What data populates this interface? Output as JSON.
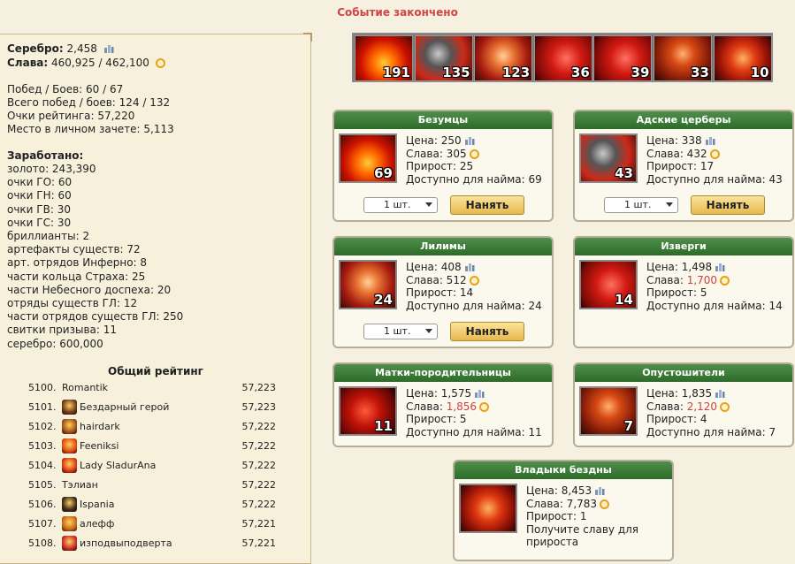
{
  "title": "Событие закончено",
  "stats": {
    "silver_label": "Серебро:",
    "silver_value": "2,458",
    "glory_label": "Слава:",
    "glory_value": "460,925 / 462,100",
    "wins": "Побед / Боев: 60 / 67",
    "total_wins": "Всего побед / боев: 124 / 132",
    "rating_points": "Очки рейтинга: 57,220",
    "personal_place": "Место в личном зачете: 5,113"
  },
  "earned": {
    "heading": "Заработано:",
    "items": [
      "золото: 243,390",
      "очки ГО: 60",
      "очки ГН: 60",
      "очки ГВ: 30",
      "очки ГС: 30",
      "бриллианты: 2",
      "артефакты существ: 72",
      "арт. отрядов Инферно: 8",
      "части кольца Страха: 25",
      "части Небесного доспеха: 20",
      "отряды существ ГЛ: 12",
      "части отрядов существ ГЛ: 250",
      "свитки призыва: 11",
      "серебро: 600,000"
    ]
  },
  "ranking": {
    "title": "Общий рейтинг",
    "rows": [
      {
        "pos": "5100.",
        "name": "Romantik",
        "points": "57,223",
        "avatar": null
      },
      {
        "pos": "5101.",
        "name": "Бездарный герой",
        "points": "57,223",
        "avatar": "#6b3a1c"
      },
      {
        "pos": "5102.",
        "name": "hairdark",
        "points": "57,222",
        "avatar": "#a0521a"
      },
      {
        "pos": "5103.",
        "name": "Feeniksi",
        "points": "57,222",
        "avatar": "#e24a10"
      },
      {
        "pos": "5104.",
        "name": "Lady SladurAna",
        "points": "57,222",
        "avatar": "#d83a14"
      },
      {
        "pos": "5105.",
        "name": "Тэлиан",
        "points": "57,222",
        "avatar": null
      },
      {
        "pos": "5106.",
        "name": "Ispania",
        "points": "57,222",
        "avatar": "#3a2a1a"
      },
      {
        "pos": "5107.",
        "name": "алефф",
        "points": "57,221",
        "avatar": "#c86a18"
      },
      {
        "pos": "5108.",
        "name": "изподвыподверта",
        "points": "57,221",
        "avatar": "#c82a2a"
      }
    ]
  },
  "strip": [
    {
      "count": "191",
      "art": "art-fire",
      "icon": "fire-icon"
    },
    {
      "count": "135",
      "art": "art-hound",
      "icon": "hound-icon"
    },
    {
      "count": "123",
      "art": "art-lilim",
      "icon": "lilim-icon"
    },
    {
      "count": "36",
      "art": "art-fiend",
      "icon": "fiend-icon"
    },
    {
      "count": "39",
      "art": "art-fiend",
      "icon": "fiend-icon"
    },
    {
      "count": "33",
      "art": "art-ravager",
      "icon": "ravager-icon"
    },
    {
      "count": "10",
      "art": "art-lord",
      "icon": "lord-icon"
    }
  ],
  "cards": {
    "bezumcy": {
      "title": "Безумцы",
      "count": "69",
      "price": "Цена: 250",
      "glory": "Слава: 305",
      "growth": "Прирост: 25",
      "available": "Доступно для найма: 69",
      "qty": "1 шт.",
      "hire": "Нанять"
    },
    "cerbery": {
      "title": "Адские церберы",
      "count": "43",
      "price": "Цена: 338",
      "glory": "Слава: 432",
      "growth": "Прирост: 17",
      "available": "Доступно для найма: 43",
      "qty": "1 шт.",
      "hire": "Нанять"
    },
    "lilimy": {
      "title": "Лилимы",
      "count": "24",
      "price": "Цена: 408",
      "glory": "Слава: 512",
      "growth": "Прирост: 14",
      "available": "Доступно для найма: 24",
      "qty": "1 шт.",
      "hire": "Нанять"
    },
    "izvergi": {
      "title": "Изверги",
      "count": "14",
      "price": "Цена: 1,498",
      "glory_label": "Слава: ",
      "glory_value": "1,700",
      "growth": "Прирост: 5",
      "available": "Доступно для найма: 14"
    },
    "matki": {
      "title": "Матки-породительницы",
      "count": "11",
      "price": "Цена: 1,575",
      "glory_label": "Слава: ",
      "glory_value": "1,856",
      "growth": "Прирост: 5",
      "available": "Доступно для найма: 11"
    },
    "opustoshiteli": {
      "title": "Опустошители",
      "count": "7",
      "price": "Цена: 1,835",
      "glory_label": "Слава: ",
      "glory_value": "2,120",
      "growth": "Прирост: 4",
      "available": "Доступно для найма: 7"
    },
    "vladyki": {
      "title": "Владыки бездны",
      "price": "Цена: 8,453",
      "glory": "Слава: 7,783",
      "growth": "Прирост: 1",
      "note1": "Получите славу для",
      "note2": "прироста"
    }
  },
  "colors": {
    "accent_red": "#d04545",
    "header_green": "#2e6b2a",
    "hire_gold": "#e7b84e"
  }
}
